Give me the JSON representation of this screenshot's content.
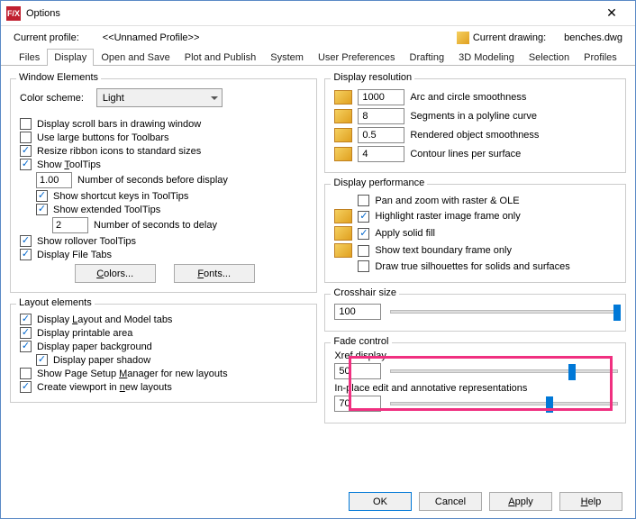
{
  "window": {
    "title": "Options",
    "icon": "F/X"
  },
  "header": {
    "profile_label": "Current profile:",
    "profile_value": "<<Unnamed Profile>>",
    "drawing_label": "Current drawing:",
    "drawing_value": "benches.dwg"
  },
  "tabs": [
    "Files",
    "Display",
    "Open and Save",
    "Plot and Publish",
    "System",
    "User Preferences",
    "Drafting",
    "3D Modeling",
    "Selection",
    "Profiles"
  ],
  "active_tab": "Display",
  "window_elements": {
    "title": "Window Elements",
    "color_scheme_label": "Color scheme:",
    "color_scheme_value": "Light",
    "scrollbars": {
      "label": "Display scroll bars in drawing window",
      "checked": false
    },
    "large_buttons": {
      "label": "Use large buttons for Toolbars",
      "checked": false
    },
    "resize_ribbon": {
      "label": "Resize ribbon icons to standard sizes",
      "checked": true
    },
    "show_tooltips": {
      "label": "Show ToolTips",
      "checked": true
    },
    "seconds_before": {
      "value": "1.00",
      "label": "Number of seconds before display"
    },
    "shortcut_keys": {
      "label": "Show shortcut keys in ToolTips",
      "checked": true
    },
    "extended_tt": {
      "label": "Show extended ToolTips",
      "checked": true
    },
    "seconds_delay": {
      "value": "2",
      "label": "Number of seconds to delay"
    },
    "rollover": {
      "label": "Show rollover ToolTips",
      "checked": true
    },
    "file_tabs": {
      "label": "Display File Tabs",
      "checked": true
    },
    "colors_btn": "Colors...",
    "fonts_btn": "Fonts..."
  },
  "layout_elements": {
    "title": "Layout elements",
    "layout_tabs": {
      "label": "Display Layout and Model tabs",
      "checked": true
    },
    "printable": {
      "label": "Display printable area",
      "checked": true
    },
    "paper_bg": {
      "label": "Display paper background",
      "checked": true
    },
    "paper_shadow": {
      "label": "Display paper shadow",
      "checked": true
    },
    "page_setup": {
      "label": "Show Page Setup Manager for new layouts",
      "checked": false
    },
    "viewport": {
      "label": "Create viewport in new layouts",
      "checked": true
    }
  },
  "display_resolution": {
    "title": "Display resolution",
    "arc": {
      "value": "1000",
      "label": "Arc and circle smoothness"
    },
    "segments": {
      "value": "8",
      "label": "Segments in a polyline curve"
    },
    "rendered": {
      "value": "0.5",
      "label": "Rendered object smoothness"
    },
    "contour": {
      "value": "4",
      "label": "Contour lines per surface"
    }
  },
  "display_performance": {
    "title": "Display performance",
    "pan_zoom": {
      "label": "Pan and zoom with raster & OLE",
      "checked": false
    },
    "highlight_raster": {
      "label": "Highlight raster image frame only",
      "checked": true
    },
    "solid_fill": {
      "label": "Apply solid fill",
      "checked": true
    },
    "text_boundary": {
      "label": "Show text boundary frame only",
      "checked": false
    },
    "silhouettes": {
      "label": "Draw true silhouettes for solids and surfaces",
      "checked": false
    }
  },
  "crosshair": {
    "title": "Crosshair size",
    "value": "100",
    "percent": 100
  },
  "fade": {
    "title": "Fade control",
    "xref_label": "Xref display",
    "xref_value": "50",
    "xref_percent": 80,
    "inplace_label": "In-place edit and annotative representations",
    "inplace_value": "70",
    "inplace_percent": 70
  },
  "footer": {
    "ok": "OK",
    "cancel": "Cancel",
    "apply": "Apply",
    "help": "Help"
  }
}
